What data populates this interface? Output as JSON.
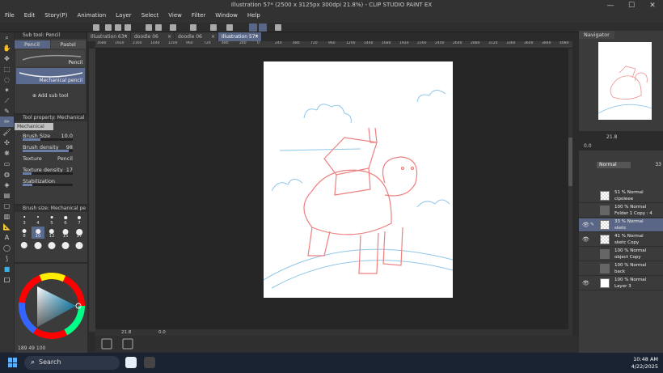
{
  "window": {
    "title": "Illustration 57* (2500 x 3125px 300dpi 21.8%) - CLIP STUDIO PAINT EX",
    "minimize": "—",
    "maximize": "☐",
    "close": "✕"
  },
  "menu": [
    "File",
    "Edit",
    "Story(P)",
    "Animation",
    "Layer",
    "Select",
    "View",
    "Filter",
    "Window",
    "Help"
  ],
  "tabs": [
    {
      "label": "Illustration 63*",
      "active": false
    },
    {
      "label": "doodle 06",
      "active": false
    },
    {
      "label": "doodle 06",
      "active": false
    },
    {
      "label": "Illustration 57*",
      "active": true
    }
  ],
  "subtool": {
    "header": "Sub tool: Pencil",
    "tabs": [
      "Pencil",
      "Pastel"
    ],
    "brushes": [
      "Pencil",
      "Mechanical pencil"
    ],
    "add_label": "Add sub tool"
  },
  "toolprop": {
    "header": "Tool property: Mechanical",
    "preset": "Mechanical pencil",
    "rows": [
      {
        "label": "Brush Size",
        "value": "10.0",
        "fill": 0.35
      },
      {
        "label": "Brush density",
        "value": "98",
        "fill": 0.92
      },
      {
        "label": "Texture",
        "value": "Pencil",
        "fill": 0
      },
      {
        "label": "Texture density",
        "value": "17",
        "fill": 0.17
      },
      {
        "label": "Stabilization",
        "value": "",
        "fill": 0.2
      }
    ]
  },
  "brushsize": {
    "header": "Brush size: Mechanical pe",
    "sizes": [
      "3",
      "4",
      "5",
      "6",
      "7",
      "8",
      "10",
      "12",
      "15",
      "17",
      "",
      "",
      "",
      "",
      ""
    ],
    "selected": "10"
  },
  "color": {
    "main": "#3ab0e0",
    "sub": "#ffffff",
    "status": "189  49  100"
  },
  "ruler": [
    "1680",
    "1920",
    "2160",
    "1440",
    "1200",
    "960",
    "720",
    "480",
    "240",
    "0",
    "240",
    "480",
    "720",
    "960",
    "1200",
    "1440",
    "1680",
    "1920",
    "2160",
    "2400",
    "2640",
    "2880",
    "3120",
    "3360",
    "3600",
    "3840",
    "4080"
  ],
  "canvas": {
    "zoom": "21.8",
    "angle": "0.0"
  },
  "navigator": {
    "title": "Navigator",
    "zoom": "21.8",
    "rotation": "0.0"
  },
  "layers": {
    "blend_mode": "Normal",
    "opacity": "33",
    "rows": [
      {
        "opacity": "51 % Normal",
        "name": "cipoleee",
        "thumb": "checker",
        "active": false,
        "visible": false
      },
      {
        "opacity": "100 % Normal",
        "name": "Folder 1 Copy : 4",
        "thumb": "folder",
        "active": false,
        "visible": false
      },
      {
        "opacity": "33 % Normal",
        "name": "sketc",
        "thumb": "checker",
        "active": true,
        "visible": true
      },
      {
        "opacity": "41 % Normal",
        "name": "sketc Copy",
        "thumb": "checker",
        "active": false,
        "visible": true
      },
      {
        "opacity": "100 % Normal",
        "name": "object Copy",
        "thumb": "folder",
        "active": false,
        "visible": false
      },
      {
        "opacity": "100 % Normal",
        "name": "back",
        "thumb": "folder",
        "active": false,
        "visible": false
      },
      {
        "opacity": "100 % Normal",
        "name": "Layer 3",
        "thumb": "white",
        "active": false,
        "visible": true
      }
    ]
  },
  "taskbar": {
    "search_placeholder": "Search",
    "time": "10:48 AM",
    "date": "4/22/2025"
  }
}
